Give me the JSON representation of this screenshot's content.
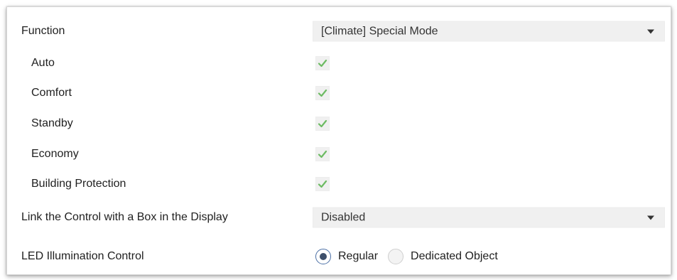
{
  "function": {
    "label": "Function",
    "value": "[Climate] Special Mode"
  },
  "modes": [
    {
      "label": "Auto",
      "checked": true
    },
    {
      "label": "Comfort",
      "checked": true
    },
    {
      "label": "Standby",
      "checked": true
    },
    {
      "label": "Economy",
      "checked": true
    },
    {
      "label": "Building Protection",
      "checked": true
    }
  ],
  "link_box": {
    "label": "Link the Control with a Box in the Display",
    "value": "Disabled"
  },
  "led": {
    "label": "LED Illumination Control",
    "options": [
      {
        "label": "Regular",
        "selected": true
      },
      {
        "label": "Dedicated Object",
        "selected": false
      }
    ]
  },
  "colors": {
    "checkmark": "#6dbb63",
    "radio_selected": "#3d4f6b"
  },
  "icons": {
    "checkmark": "check-icon",
    "dropdown": "chevron-down-icon"
  }
}
